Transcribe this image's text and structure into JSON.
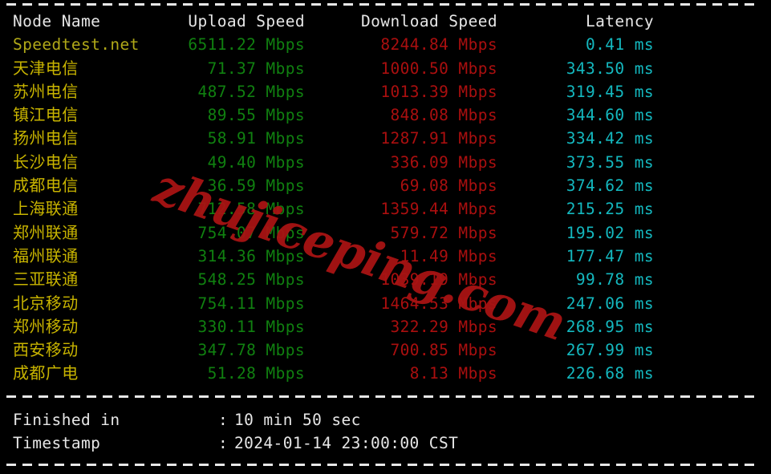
{
  "terminal": {
    "separator_char": "-",
    "watermark": "zhujiceping.com"
  },
  "table": {
    "headers": {
      "node_name": "Node Name",
      "upload_speed": "Upload Speed",
      "download_speed": "Download Speed",
      "latency": "Latency"
    },
    "rows": [
      {
        "name": "Speedtest.net",
        "upload": "6511.22 Mbps",
        "download": "8244.84 Mbps",
        "latency": "0.41 ms",
        "kind": "reference"
      },
      {
        "name": "天津电信",
        "upload": "71.37 Mbps",
        "download": "1000.50 Mbps",
        "latency": "343.50 ms",
        "kind": "node"
      },
      {
        "name": "苏州电信",
        "upload": "487.52 Mbps",
        "download": "1013.39 Mbps",
        "latency": "319.45 ms",
        "kind": "node"
      },
      {
        "name": "镇江电信",
        "upload": "89.55 Mbps",
        "download": "848.08 Mbps",
        "latency": "344.60 ms",
        "kind": "node"
      },
      {
        "name": "扬州电信",
        "upload": "58.91 Mbps",
        "download": "1287.91 Mbps",
        "latency": "334.42 ms",
        "kind": "node"
      },
      {
        "name": "长沙电信",
        "upload": "49.40 Mbps",
        "download": "336.09 Mbps",
        "latency": "373.55 ms",
        "kind": "node"
      },
      {
        "name": "成都电信",
        "upload": "36.59 Mbps",
        "download": "69.08 Mbps",
        "latency": "374.62 ms",
        "kind": "node"
      },
      {
        "name": "上海联通",
        "upload": "712.58 Mbps",
        "download": "1359.44 Mbps",
        "latency": "215.25 ms",
        "kind": "node"
      },
      {
        "name": "郑州联通",
        "upload": "754.07 Mbps",
        "download": "579.72 Mbps",
        "latency": "195.02 ms",
        "kind": "node"
      },
      {
        "name": "福州联通",
        "upload": "314.36 Mbps",
        "download": "11.49 Mbps",
        "latency": "177.47 ms",
        "kind": "node"
      },
      {
        "name": "三亚联通",
        "upload": "548.25 Mbps",
        "download": "1039.19 Mbps",
        "latency": "99.78 ms",
        "kind": "node"
      },
      {
        "name": "北京移动",
        "upload": "754.11 Mbps",
        "download": "1464.53 Mbps",
        "latency": "247.06 ms",
        "kind": "node"
      },
      {
        "name": "郑州移动",
        "upload": "330.11 Mbps",
        "download": "322.29 Mbps",
        "latency": "268.95 ms",
        "kind": "node"
      },
      {
        "name": "西安移动",
        "upload": "347.78 Mbps",
        "download": "700.85 Mbps",
        "latency": "267.99 ms",
        "kind": "node"
      },
      {
        "name": "成都广电",
        "upload": "51.28 Mbps",
        "download": "8.13 Mbps",
        "latency": "226.68 ms",
        "kind": "node"
      }
    ]
  },
  "footer": {
    "finished_label": "Finished in",
    "finished_colon": ":",
    "finished_value": "10 min 50 sec",
    "timestamp_label": "Timestamp",
    "timestamp_colon": ":",
    "timestamp_value": "2024-01-14 23:00:00 CST"
  },
  "colors": {
    "background": "#000000",
    "header_text": "#e6e6e6",
    "reference_name": "#b0a818",
    "node_name": "#c8b400",
    "upload": "#108010",
    "download": "#aa0f0f",
    "latency": "#14b8bf",
    "separator": "#e8e8e8",
    "watermark": "#a81414"
  }
}
